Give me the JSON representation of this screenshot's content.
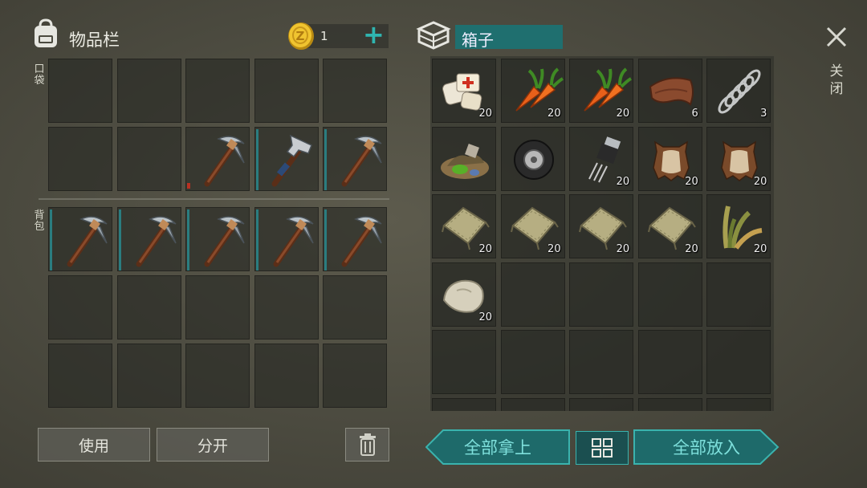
{
  "inventory": {
    "title": "物品栏",
    "pocket_label": "口袋",
    "backpack_label": "背包"
  },
  "currency": {
    "amount": "1",
    "add_symbol": "+"
  },
  "container": {
    "title": "箱子",
    "close_label": "关闭"
  },
  "actions": {
    "use": "使用",
    "split": "分开",
    "take_all": "全部拿上",
    "put_all": "全部放入"
  },
  "colors": {
    "accent": "#2a9b9a",
    "accent_text": "#7ee0dc",
    "durability": "#2a7d80",
    "durability_low": "#b83022"
  },
  "pocket_items": [
    {
      "slot": 7,
      "item": "pickaxe",
      "durability": "low"
    },
    {
      "slot": 8,
      "item": "hammer"
    },
    {
      "slot": 9,
      "item": "pickaxe"
    }
  ],
  "backpack_items": [
    {
      "slot": 0,
      "item": "pickaxe"
    },
    {
      "slot": 1,
      "item": "pickaxe"
    },
    {
      "slot": 2,
      "item": "pickaxe"
    },
    {
      "slot": 3,
      "item": "pickaxe"
    },
    {
      "slot": 4,
      "item": "pickaxe"
    }
  ],
  "box_items": [
    {
      "item": "bandage",
      "qty": "20"
    },
    {
      "item": "carrot",
      "qty": "20"
    },
    {
      "item": "carrot",
      "qty": "20"
    },
    {
      "item": "leather",
      "qty": "6"
    },
    {
      "item": "spring",
      "qty": "3"
    },
    {
      "item": "rotten-food",
      "qty": ""
    },
    {
      "item": "tire",
      "qty": ""
    },
    {
      "item": "transistor",
      "qty": "20"
    },
    {
      "item": "animal-hide",
      "qty": "20"
    },
    {
      "item": "animal-hide",
      "qty": "20"
    },
    {
      "item": "cloth",
      "qty": "20"
    },
    {
      "item": "cloth",
      "qty": "20"
    },
    {
      "item": "cloth",
      "qty": "20"
    },
    {
      "item": "cloth",
      "qty": "20"
    },
    {
      "item": "plant-fiber",
      "qty": "20"
    },
    {
      "item": "stone",
      "qty": "20"
    }
  ]
}
